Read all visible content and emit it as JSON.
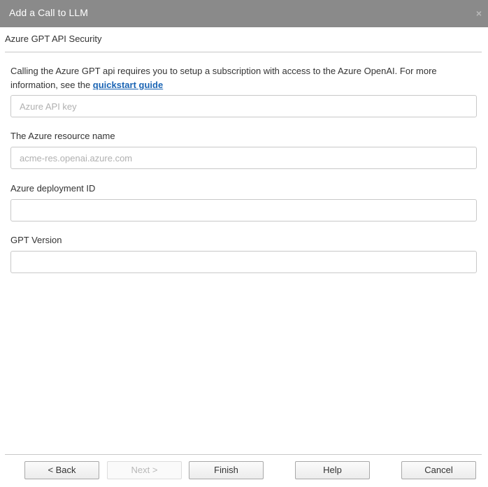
{
  "window": {
    "title": "Add a Call to LLM",
    "close_label": "×"
  },
  "section": {
    "title": "Azure GPT API Security"
  },
  "description": {
    "text": "Calling the Azure GPT api requires you to setup a subscription with access to the Azure OpenAI. For more information, see the ",
    "link_label": "quickstart guide"
  },
  "fields": {
    "api_key": {
      "label": "",
      "placeholder": "Azure API key",
      "value": ""
    },
    "resource_name": {
      "label": "The Azure resource name",
      "placeholder": "acme-res.openai.azure.com",
      "value": ""
    },
    "deployment_id": {
      "label": "Azure deployment ID",
      "placeholder": "",
      "value": ""
    },
    "gpt_version": {
      "label": "GPT Version",
      "placeholder": "",
      "value": ""
    }
  },
  "buttons": {
    "back": "< Back",
    "next": "Next >",
    "finish": "Finish",
    "help": "Help",
    "cancel": "Cancel"
  },
  "colors": {
    "titlebar": "#8a8a8a",
    "link": "#1a64b4"
  }
}
